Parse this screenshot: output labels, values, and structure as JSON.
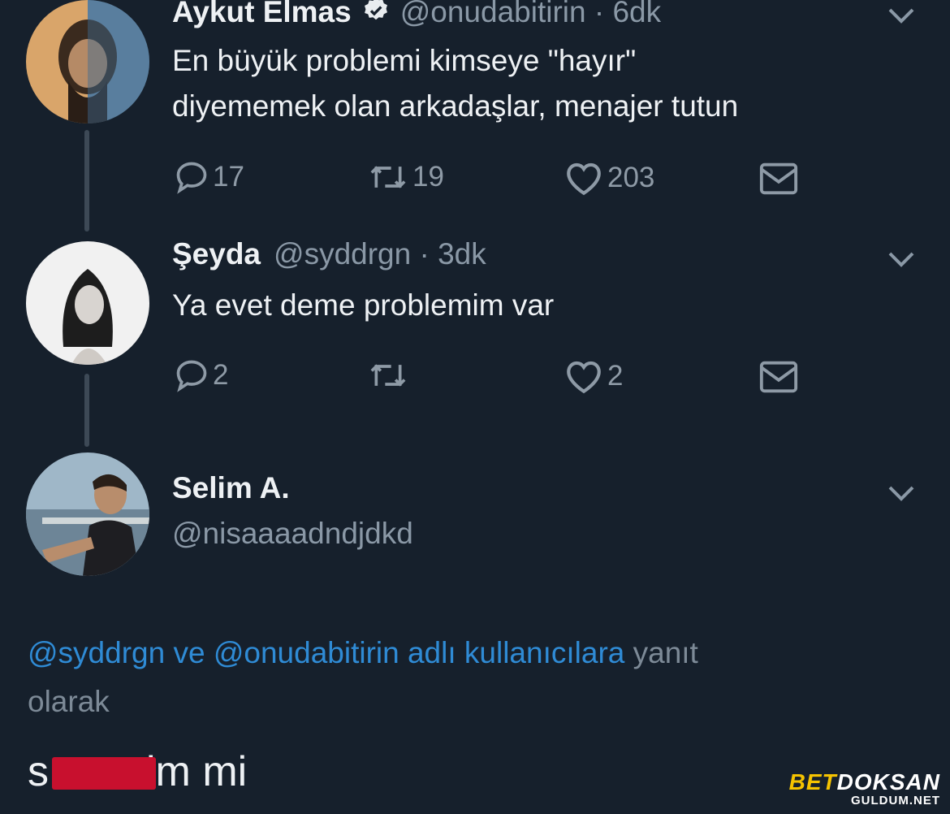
{
  "tweets": [
    {
      "name": "Aykut Elmas",
      "handle": "@onudabitirin · 6dk",
      "text_line1": "En büyük problemi kimseye \"hayır\"",
      "text_line2": "diyememek olan arkadaşlar, menajer tutun",
      "replies": "17",
      "retweets": "19",
      "likes": "203",
      "verified": true
    },
    {
      "name": "Şeyda",
      "handle": "@syddrgn · 3dk",
      "text_line1": "Ya evet deme problemim var",
      "replies": "2",
      "retweets": "",
      "likes": "2"
    },
    {
      "name": "Selim A.",
      "handle": "@nisaaaadndjdkd"
    }
  ],
  "reply_context": {
    "mentions": "@syddrgn ve @onudabitirin adlı kullanıcılara",
    "suffix": "yanıt",
    "line2": "olarak"
  },
  "reply_text": {
    "start": "s",
    "end": "im mi"
  },
  "watermark": {
    "brand_a": "BET",
    "brand_b": "DOKSAN",
    "site": "GULDUM.NET"
  },
  "colors": {
    "background": "#16202c",
    "link": "#2f8bd5",
    "muted": "#8a98a6"
  }
}
